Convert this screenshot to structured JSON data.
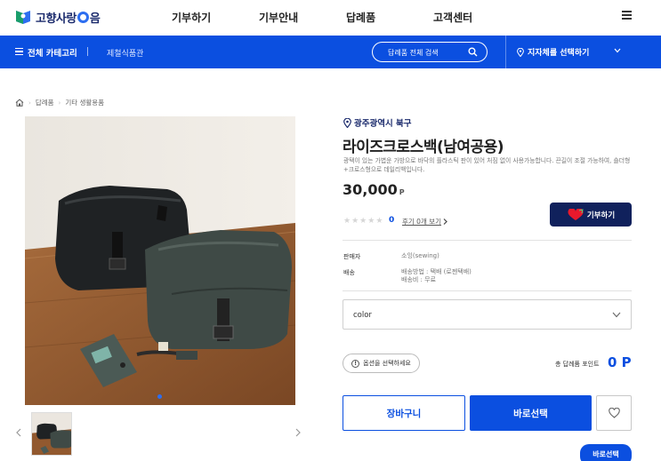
{
  "header": {
    "logo_text": "고향사랑e음",
    "nav": [
      "기부하기",
      "기부안내",
      "답례품",
      "고객센터"
    ]
  },
  "category_bar": {
    "all_categories": "전체 카테고리",
    "subcategory": "제철식품관",
    "search_placeholder": "답례품 전체 검색",
    "region_select": "지자체를 선택하기"
  },
  "breadcrumb": [
    "답례품",
    "기타 생활용품"
  ],
  "product": {
    "location": "광주광역시 북구",
    "title": "라이즈크로스백(남여공용)",
    "description": "광택이 있는 가볍운 가방으로 바닥의 플라스틱 판이 있어 처짐 없이 사용가능합니다. 끈길이 조절 가능하여, 숄더형+크로스형으로 데일리백입니다.",
    "price": "30,000",
    "price_unit": "P",
    "rating": 0,
    "review_count": "0",
    "review_link": "후기 0개 보기",
    "donate_button": "기부하기",
    "seller_label": "판매자",
    "seller_value": "소잉(sewing)",
    "delivery_label": "배송",
    "delivery_method": "배송방법 : 택배 (로젠택배)",
    "delivery_fee": "배송비 : 무료",
    "option_select": "color",
    "option_hint": "옵션을 선택하세요",
    "total_label": "총 답례품 포인트",
    "total_value": "0 P",
    "cart_button": "장바구니",
    "buy_button": "바로선택",
    "floating_button": "바로선택"
  },
  "colors": {
    "primary": "#0b4fe0",
    "navy": "#10215c",
    "heart": "#e8192c"
  }
}
